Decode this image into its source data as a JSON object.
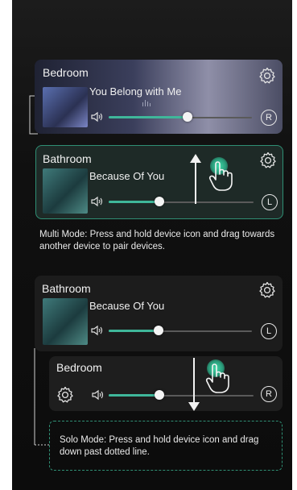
{
  "multi_mode": {
    "cards": [
      {
        "room": "Bedroom",
        "song": "You Belong with Me",
        "channel": "R",
        "volume": 0.55
      },
      {
        "room": "Bathroom",
        "song": "Because Of You",
        "channel": "L",
        "volume": 0.35
      }
    ],
    "instruction": "Multi Mode: Press and hold device icon and drag towards another device to pair devices."
  },
  "solo_mode": {
    "cards": [
      {
        "room": "Bathroom",
        "song": "Because Of You",
        "channel": "L",
        "volume": 0.35
      },
      {
        "room": "Bedroom",
        "channel": "R",
        "volume": 0.35
      }
    ],
    "instruction": "Solo Mode: Press and hold device icon and drag down past dotted line."
  },
  "icons": [
    "gear-icon",
    "speaker-volume-icon",
    "hand-pointer-icon",
    "arrow-up-icon",
    "arrow-down-icon",
    "equalizer-icon"
  ],
  "colors": {
    "accent": "#3fb79a",
    "background": "#101010",
    "card_border": "#2f8f74"
  }
}
